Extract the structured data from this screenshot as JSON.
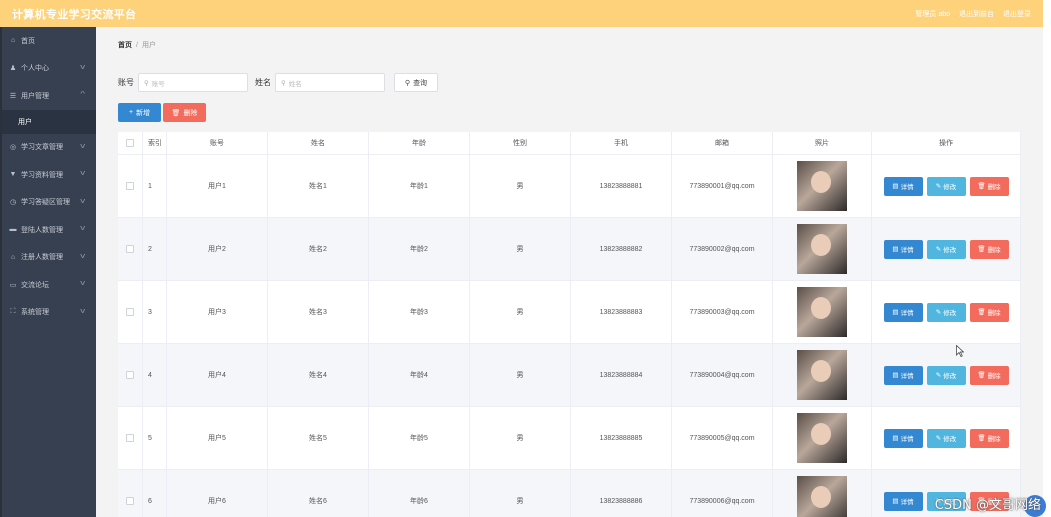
{
  "app": {
    "title": "计算机专业学习交流平台",
    "top_links": [
      "管理员 abo",
      "退出到前台",
      "退出登录"
    ]
  },
  "sidebar": {
    "items": [
      {
        "label": "首页",
        "icon": "home-icon",
        "glyph": "⌂",
        "chevron": false
      },
      {
        "label": "个人中心",
        "icon": "person-icon",
        "glyph": "♟",
        "chevron": true
      },
      {
        "label": "用户管理",
        "icon": "menu-icon",
        "glyph": "☰",
        "chevron": true,
        "expanded": true
      },
      {
        "label": "学习文章管理",
        "icon": "compass-icon",
        "glyph": "◎",
        "chevron": true
      },
      {
        "label": "学习资料管理",
        "icon": "filter-icon",
        "glyph": "▼",
        "chevron": true
      },
      {
        "label": "学习答疑区管理",
        "icon": "clock-icon",
        "glyph": "◷",
        "chevron": true
      },
      {
        "label": "登陆人数管理",
        "icon": "card-icon",
        "glyph": "▬",
        "chevron": true
      },
      {
        "label": "注册人数管理",
        "icon": "bank-icon",
        "glyph": "⌂",
        "chevron": true
      },
      {
        "label": "交流论坛",
        "icon": "chat-icon",
        "glyph": "▭",
        "chevron": true
      },
      {
        "label": "系统管理",
        "icon": "settings-icon",
        "glyph": "⛶",
        "chevron": true
      }
    ],
    "sub_item": "用户"
  },
  "breadcrumb": {
    "home": "首页",
    "sep": "/",
    "current": "用户"
  },
  "search": {
    "account_label": "账号",
    "account_placeholder": "账号",
    "name_label": "姓名",
    "name_placeholder": "姓名",
    "query_label": "查询"
  },
  "actions": {
    "add": "新增",
    "delete": "删除"
  },
  "table": {
    "headers": [
      "索引",
      "账号",
      "姓名",
      "年龄",
      "性别",
      "手机",
      "邮箱",
      "照片",
      "操作"
    ],
    "op_labels": {
      "detail": "详情",
      "edit": "修改",
      "remove": "删除"
    },
    "rows": [
      {
        "idx": "1",
        "account": "用户1",
        "name": "姓名1",
        "age": "年龄1",
        "sex": "男",
        "phone": "13823888881",
        "email": "773890001@qq.com"
      },
      {
        "idx": "2",
        "account": "用户2",
        "name": "姓名2",
        "age": "年龄2",
        "sex": "男",
        "phone": "13823888882",
        "email": "773890002@qq.com"
      },
      {
        "idx": "3",
        "account": "用户3",
        "name": "姓名3",
        "age": "年龄3",
        "sex": "男",
        "phone": "13823888883",
        "email": "773890003@qq.com"
      },
      {
        "idx": "4",
        "account": "用户4",
        "name": "姓名4",
        "age": "年龄4",
        "sex": "男",
        "phone": "13823888884",
        "email": "773890004@qq.com"
      },
      {
        "idx": "5",
        "account": "用户5",
        "name": "姓名5",
        "age": "年龄5",
        "sex": "男",
        "phone": "13823888885",
        "email": "773890005@qq.com"
      },
      {
        "idx": "6",
        "account": "用户6",
        "name": "姓名6",
        "age": "年龄6",
        "sex": "男",
        "phone": "13823888886",
        "email": "773890006@qq.com"
      }
    ]
  },
  "watermark": "CSDN @文哥网络",
  "colors": {
    "topbar": "#fdd27b",
    "sidebar": "#374050",
    "primary": "#3388d1",
    "danger": "#f36b5c",
    "info": "#50b6e0"
  }
}
